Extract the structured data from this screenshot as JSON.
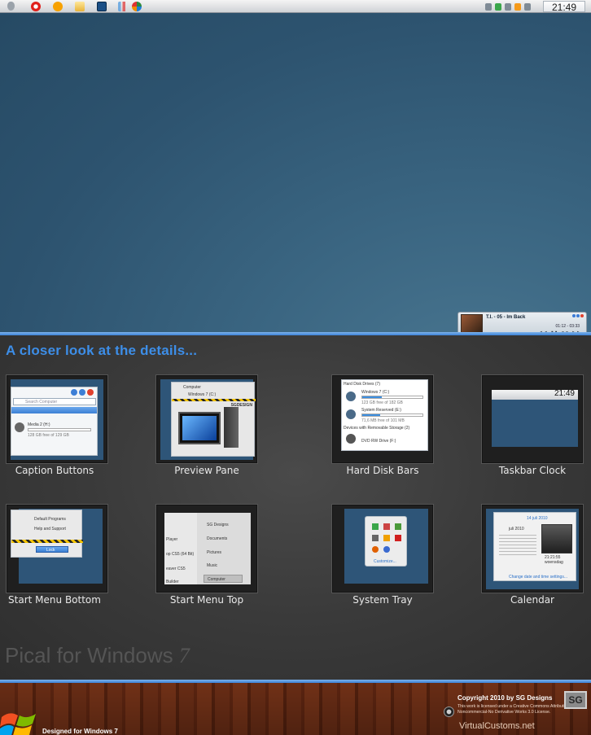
{
  "taskbar": {
    "clock": "21:49"
  },
  "player": {
    "track": "T.I. - 05 - Im Back",
    "time": "01:12 - 03:33",
    "controls": "◀◀   ▮▮   ■■   ▶▶"
  },
  "details": {
    "heading": "A closer look at the details...",
    "tiles": [
      {
        "label": "Caption Buttons"
      },
      {
        "label": "Preview Pane"
      },
      {
        "label": "Hard Disk Bars"
      },
      {
        "label": "Taskbar Clock"
      },
      {
        "label": "Start Menu Bottom"
      },
      {
        "label": "Start Menu Top"
      },
      {
        "label": "System Tray"
      },
      {
        "label": "Calendar"
      }
    ],
    "caption_tile": {
      "search": "Search Computer",
      "drive": "Media 2 (H:)",
      "free": "128 GB free of 129 GB"
    },
    "preview_tile": {
      "computer": "Computer",
      "drive": "Windows 7 (C:)",
      "tag": "SGDESIGN"
    },
    "disk_tile": {
      "group1": "Hard Disk Drives (7)",
      "d1": "Windows 7 (C:)",
      "d1free": "123 GB free of 182 GB",
      "d2": "System Reserved (E:)",
      "d2free": "71,6 MB free of 101 MB",
      "group2": "Devices with Removable Storage (2)",
      "d3": "DVD RW Drive (F:)"
    },
    "clock_tile": {
      "clock": "21:49"
    },
    "startbottom_tile": {
      "item1": "Default Programs",
      "item2": "Help and Support",
      "lock": "Lock"
    },
    "starttop_tile": {
      "left": [
        "Player",
        "op CS5 (64 Bit)",
        "eaver CS5",
        "Builder"
      ],
      "right": [
        "SG Designs",
        "Documents",
        "Pictures",
        "Music",
        "Computer"
      ]
    },
    "tray_tile": {
      "customize": "Customize..."
    },
    "calendar_tile": {
      "date": "14 juli 2010",
      "month": "juli 2010",
      "time": "21:21:55",
      "day": "woensdag",
      "link": "Change date and time settings..."
    },
    "title": "Pical for Windows",
    "title_num": "7"
  },
  "footer": {
    "designed": "Designed for Windows 7",
    "copyright": "Copyright 2010 by SG Designs",
    "license": "This work is licensed under a Creative Commons Attribution-Noncommercial-No Derivative Works 3.0 License.",
    "site": "VirtualCustoms.net",
    "sg": "SG"
  }
}
